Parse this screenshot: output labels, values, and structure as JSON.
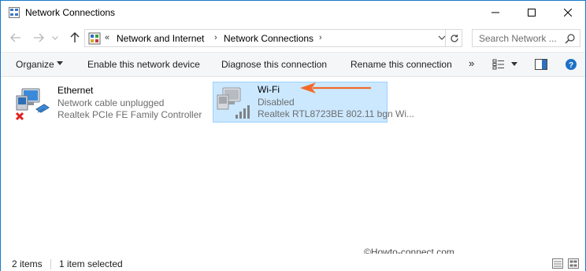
{
  "window": {
    "title": "Network Connections"
  },
  "address": {
    "overflow": "«",
    "crumbs": [
      "Network and Internet",
      "Network Connections"
    ],
    "search_placeholder": "Search Network ..."
  },
  "toolbar": {
    "organize": "Organize",
    "enable": "Enable this network device",
    "diagnose": "Diagnose this connection",
    "rename": "Rename this connection",
    "more": "»"
  },
  "items": [
    {
      "name": "Ethernet",
      "status": "Network cable unplugged",
      "device": "Realtek PCIe FE Family Controller",
      "selected": false,
      "icon": "ethernet-adapter-icon"
    },
    {
      "name": "Wi-Fi",
      "status": "Disabled",
      "device": "Realtek RTL8723BE 802.11 bgn Wi...",
      "selected": true,
      "icon": "wifi-adapter-icon"
    }
  ],
  "watermark": "©Howto-connect.com",
  "statusbar": {
    "count": "2 items",
    "selected": "1 item selected"
  },
  "colors": {
    "selection_bg": "#cce8ff",
    "selection_border": "#99d1ff",
    "annotation_arrow": "#f26b2a",
    "window_border": "#1979ca"
  }
}
